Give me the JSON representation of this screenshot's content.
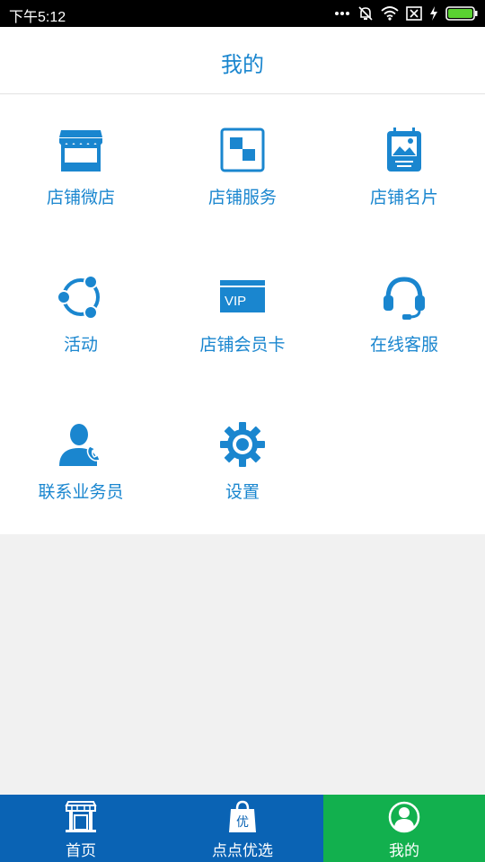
{
  "status_bar": {
    "time": "下午5:12"
  },
  "header": {
    "title": "我的"
  },
  "menu": {
    "items": [
      {
        "label": "店铺微店",
        "icon": "storefront-icon"
      },
      {
        "label": "店铺服务",
        "icon": "squares-icon"
      },
      {
        "label": "店铺名片",
        "icon": "business-card-icon"
      },
      {
        "label": "活动",
        "icon": "share-circle-icon"
      },
      {
        "label": "店铺会员卡",
        "icon": "vip-card-icon"
      },
      {
        "label": "在线客服",
        "icon": "headset-icon"
      },
      {
        "label": "联系业务员",
        "icon": "salesperson-phone-icon"
      },
      {
        "label": "设置",
        "icon": "gear-icon"
      }
    ],
    "vip_text": "VIP"
  },
  "tabbar": {
    "tabs": [
      {
        "label": "首页",
        "icon": "shop-front-icon"
      },
      {
        "label": "点点优选",
        "icon": "shopping-bag-icon",
        "icon_text": "优"
      },
      {
        "label": "我的",
        "icon": "user-circle-icon"
      }
    ],
    "active_index": 2
  },
  "colors": {
    "accent": "#1a86cf",
    "tab_bar": "#0a63b4",
    "tab_active": "#12b04e"
  }
}
